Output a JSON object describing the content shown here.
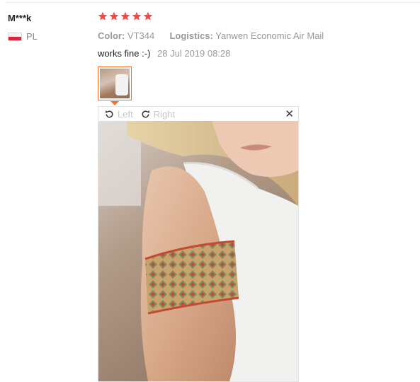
{
  "reviewer": {
    "name": "M***k",
    "country_code": "PL",
    "flag_colors": [
      "#f4f4f4",
      "#d62640"
    ]
  },
  "rating": {
    "stars": 5,
    "max": 5,
    "color": "#f04a4a"
  },
  "meta": {
    "color_label": "Color:",
    "color_value": "VT344",
    "logistics_label": "Logistics:",
    "logistics_value": "Yanwen Economic Air Mail"
  },
  "review": {
    "text": "works fine :-)",
    "date": "28 Jul 2019 08:28"
  },
  "viewer": {
    "left_label": "Left",
    "right_label": "Right",
    "close_icon": "close-icon",
    "accent": "#f0732a"
  }
}
